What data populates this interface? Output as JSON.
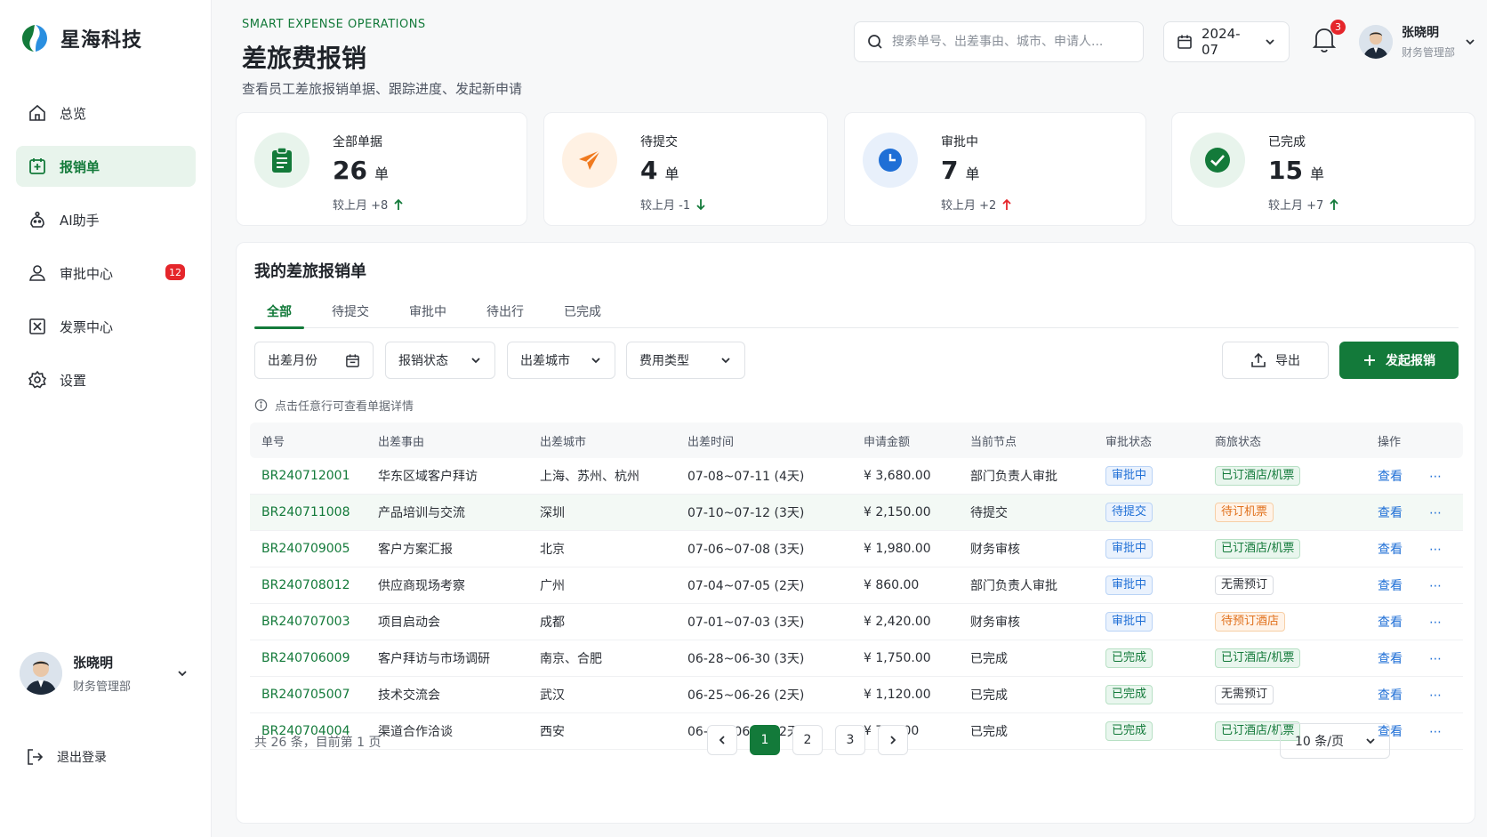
{
  "brand": {
    "name": "星海科技"
  },
  "nav": {
    "items": [
      {
        "label": "总览",
        "icon": "home-icon"
      },
      {
        "label": "报销单",
        "icon": "receipt-icon",
        "active": true
      },
      {
        "label": "AI助手",
        "icon": "robot-icon"
      },
      {
        "label": "审批中心",
        "icon": "user-icon",
        "badge": "12"
      },
      {
        "label": "发票中心",
        "icon": "invoice-icon"
      },
      {
        "label": "设置",
        "icon": "gear-icon"
      }
    ]
  },
  "sidebar_user": {
    "name": "张晓明",
    "dept": "财务管理部"
  },
  "logout_label": "退出登录",
  "header": {
    "eyebrow": "SMART EXPENSE OPERATIONS",
    "title": "差旅费报销",
    "subtitle": "查看员工差旅报销单据、跟踪进度、发起新申请",
    "search_placeholder": "搜索单号、出差事由、城市、申请人...",
    "month": "2024-07",
    "notifications": "3",
    "user_name": "张晓明",
    "user_dept": "财务管理部"
  },
  "stats": [
    {
      "label": "全部单据",
      "value": "26",
      "unit": "单",
      "delta": "较上月 +8",
      "trend": "up",
      "color": "#137a3a",
      "bg": "#e8f4ec"
    },
    {
      "label": "待提交",
      "value": "4",
      "unit": "单",
      "delta": "较上月 -1",
      "trend": "down",
      "color": "#f07a1f",
      "bg": "#fff1e3"
    },
    {
      "label": "审批中",
      "value": "7",
      "unit": "单",
      "delta": "较上月 +2",
      "trend": "up-red",
      "color": "#1f6fd6",
      "bg": "#e8f0fb"
    },
    {
      "label": "已完成",
      "value": "15",
      "unit": "单",
      "delta": "较上月 +7",
      "trend": "up",
      "color": "#137a3a",
      "bg": "#e8f4ec"
    }
  ],
  "panel": {
    "title": "我的差旅报销单",
    "tabs": [
      "全部",
      "待提交",
      "审批中",
      "待出行",
      "已完成"
    ],
    "filters": [
      "出差月份",
      "报销状态",
      "出差城市",
      "费用类型"
    ],
    "export_label": "导出",
    "new_label": "发起报销",
    "hint": "点击任意行可查看单据详情",
    "columns": [
      "单号",
      "出差事由",
      "出差城市",
      "出差时间",
      "申请金额",
      "当前节点",
      "审批状态",
      "商旅状态",
      "操作"
    ],
    "rows": [
      {
        "id": "BR240712001",
        "reason": "华东区域客户拜访",
        "city": "上海、苏州、杭州",
        "time": "07-08~07-11 (4天)",
        "amount": "¥ 3,680.00",
        "node": "部门负责人审批",
        "status": "审批中",
        "status_type": "blue",
        "travel": "已订酒店/机票",
        "travel_type": "green",
        "action": "查看"
      },
      {
        "id": "BR240711008",
        "reason": "产品培训与交流",
        "city": "深圳",
        "time": "07-10~07-12 (3天)",
        "amount": "¥ 2,150.00",
        "node": "待提交",
        "status": "待提交",
        "status_type": "blue",
        "travel": "待订机票",
        "travel_type": "orange",
        "action": "查看"
      },
      {
        "id": "BR240709005",
        "reason": "客户方案汇报",
        "city": "北京",
        "time": "07-06~07-08 (3天)",
        "amount": "¥ 1,980.00",
        "node": "财务审核",
        "status": "审批中",
        "status_type": "blue",
        "travel": "已订酒店/机票",
        "travel_type": "green",
        "action": "查看"
      },
      {
        "id": "BR240708012",
        "reason": "供应商现场考察",
        "city": "广州",
        "time": "07-04~07-05 (2天)",
        "amount": "¥ 860.00",
        "node": "部门负责人审批",
        "status": "审批中",
        "status_type": "blue",
        "travel": "无需预订",
        "travel_type": "gray",
        "action": "查看"
      },
      {
        "id": "BR240707003",
        "reason": "项目启动会",
        "city": "成都",
        "time": "07-01~07-03 (3天)",
        "amount": "¥ 2,420.00",
        "node": "财务审核",
        "status": "审批中",
        "status_type": "blue",
        "travel": "待预订酒店",
        "travel_type": "orange",
        "action": "查看"
      },
      {
        "id": "BR240706009",
        "reason": "客户拜访与市场调研",
        "city": "南京、合肥",
        "time": "06-28~06-30 (3天)",
        "amount": "¥ 1,750.00",
        "node": "已完成",
        "status": "已完成",
        "status_type": "green",
        "travel": "已订酒店/机票",
        "travel_type": "green",
        "action": "查看"
      },
      {
        "id": "BR240705007",
        "reason": "技术交流会",
        "city": "武汉",
        "time": "06-25~06-26 (2天)",
        "amount": "¥ 1,120.00",
        "node": "已完成",
        "status": "已完成",
        "status_type": "green",
        "travel": "无需预订",
        "travel_type": "gray",
        "action": "查看"
      },
      {
        "id": "BR240704004",
        "reason": "渠道合作洽谈",
        "city": "西安",
        "time": "06-20~06-21 (2天)",
        "amount": "¥ 780.00",
        "node": "已完成",
        "status": "已完成",
        "status_type": "green",
        "travel": "已订酒店/机票",
        "travel_type": "green",
        "action": "查看"
      }
    ],
    "total_text": "共 26 条，目前第 1 页",
    "pages": [
      "1",
      "2",
      "3"
    ],
    "page_size": "10 条/页"
  }
}
